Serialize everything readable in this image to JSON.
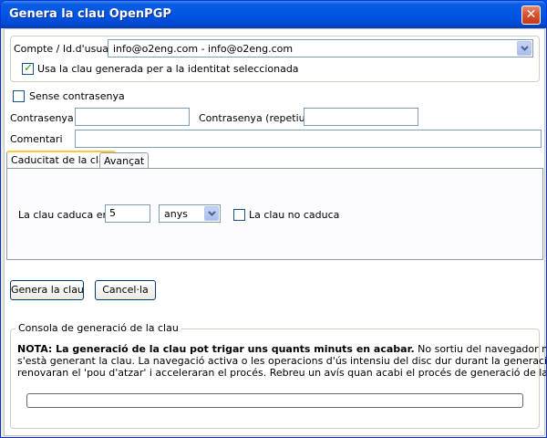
{
  "window": {
    "title": "Genera la clau OpenPGP",
    "close_glyph": "✕"
  },
  "account": {
    "label": "Compte / Id.d'usuari",
    "selected": "info@o2eng.com - info@o2eng.com",
    "use_key_label": "Usa la clau generada per a la identitat seleccionada",
    "use_key_checked": true
  },
  "passphrase": {
    "no_passphrase_label": "Sense contrasenya",
    "no_passphrase_checked": false,
    "passphrase_label": "Contrasenya",
    "passphrase_value": "",
    "repeat_label": "Contrasenya (repetiu)",
    "repeat_value": ""
  },
  "comment": {
    "label": "Comentari",
    "value": ""
  },
  "tabs": [
    {
      "label": "Caducitat de la clau",
      "active": true
    },
    {
      "label": "Avançat",
      "active": false
    }
  ],
  "expiry": {
    "label": "La clau caduca en",
    "amount": "5",
    "unit": "anys",
    "never_label": "La clau no caduca",
    "never_checked": false
  },
  "buttons": {
    "generate": "Genera la clau",
    "cancel": "Cancel·la"
  },
  "console": {
    "legend": "Consola de generació de la clau",
    "note_bold": "NOTA: La generació de la clau pot trigar uns quants minuts en acabar.",
    "note_rest_1": " No sortiu del navegador mentre",
    "note_line_2": "s'està generant la clau. La navegació activa o les operacions d'ús intensiu del disc dur durant la generació de la clau",
    "note_line_3": "renovaran el 'pou d'atzar' i acceleraran el procés. Rebreu un avís quan acabi el procés de generació de la clau.",
    "progress": 0
  },
  "icons": {
    "check": "✓",
    "dropdown": "chevron-down-icon"
  }
}
